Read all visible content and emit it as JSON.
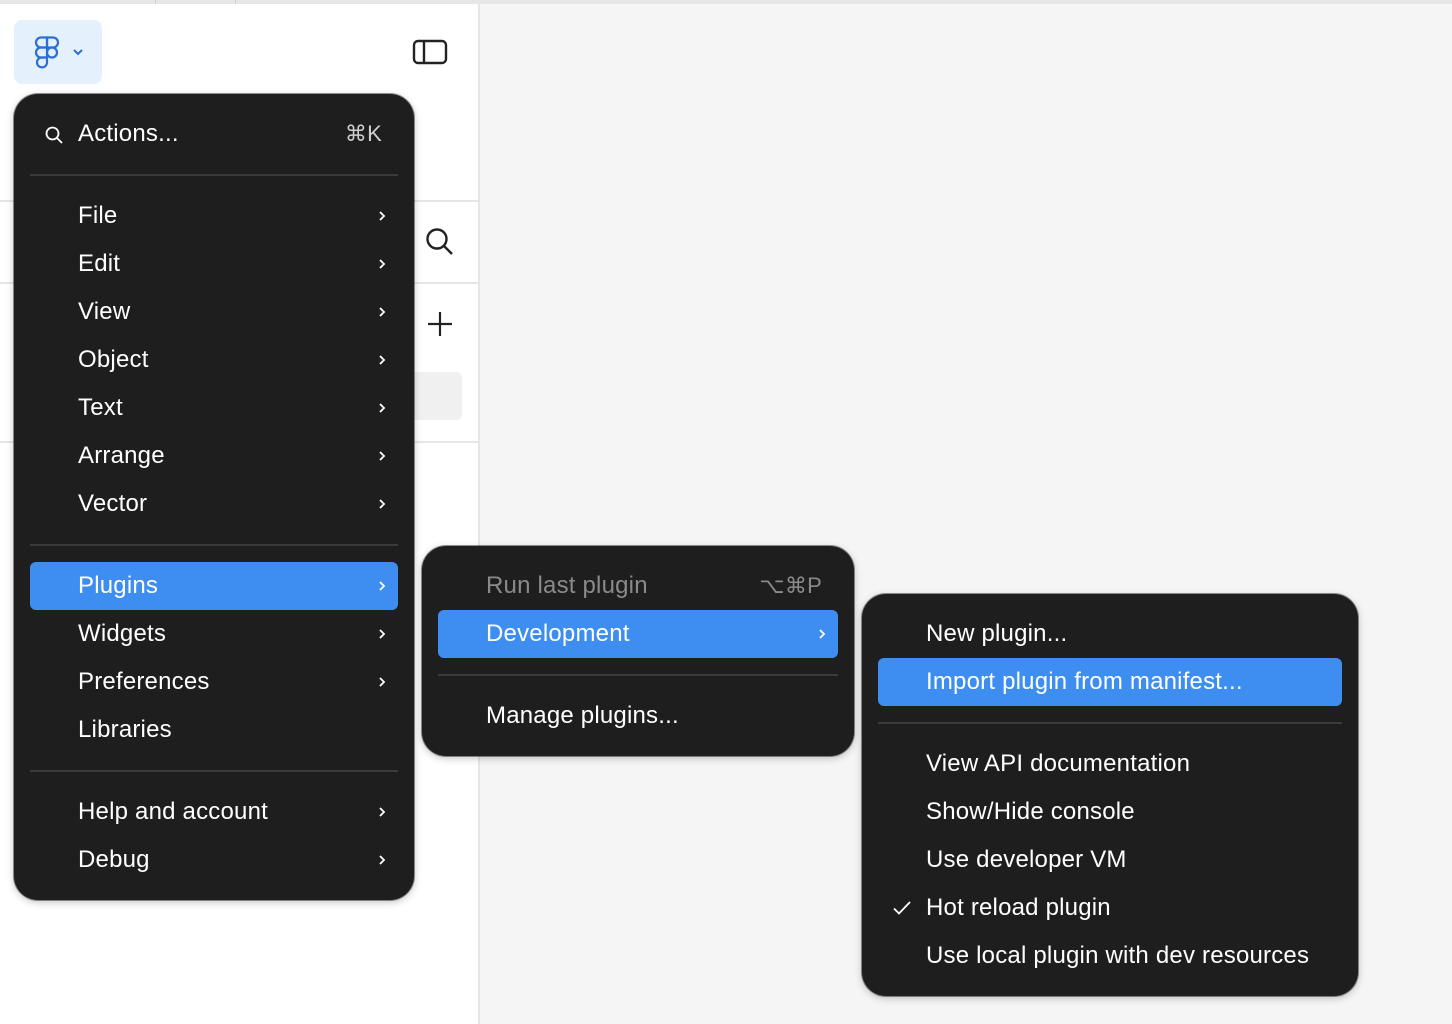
{
  "main_menu": {
    "search_label": "Actions...",
    "search_shortcut": "⌘K",
    "items": [
      {
        "label": "File"
      },
      {
        "label": "Edit"
      },
      {
        "label": "View"
      },
      {
        "label": "Object"
      },
      {
        "label": "Text"
      },
      {
        "label": "Arrange"
      },
      {
        "label": "Vector"
      },
      {
        "label": "Plugins"
      },
      {
        "label": "Widgets"
      },
      {
        "label": "Preferences"
      },
      {
        "label": "Libraries"
      },
      {
        "label": "Help and account"
      },
      {
        "label": "Debug"
      }
    ],
    "selected": "Plugins"
  },
  "plugins_menu": {
    "run_last": "Run last plugin",
    "run_last_shortcut": "⌥⌘P",
    "development": "Development",
    "manage": "Manage plugins..."
  },
  "development_menu": {
    "new_plugin": "New plugin...",
    "import_manifest": "Import plugin from manifest...",
    "view_api_docs": "View API documentation",
    "show_hide_console": "Show/Hide console",
    "use_developer_vm": "Use developer VM",
    "hot_reload": "Hot reload plugin",
    "hot_reload_checked": true,
    "use_local_dev": "Use local plugin with dev resources"
  },
  "colors": {
    "menu_bg": "#1e1e1e",
    "highlight": "#3d8ef0",
    "logo_bg": "#e5f0fd"
  }
}
